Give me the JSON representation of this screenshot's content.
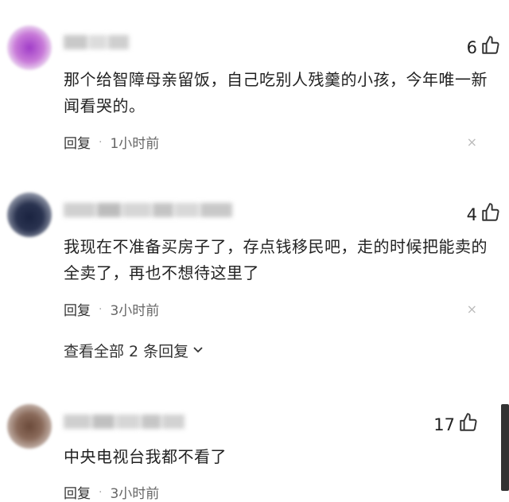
{
  "comments": [
    {
      "likes": "6",
      "text": "那个给智障母亲留饭，自己吃别人残羹的小孩，今年唯一新闻看哭的。",
      "reply_label": "回复",
      "separator": "·",
      "time": "1小时前",
      "close": "×"
    },
    {
      "likes": "4",
      "text": "我现在不准备买房子了，存点钱移民吧，走的时候把能卖的全卖了，再也不想待这里了",
      "reply_label": "回复",
      "separator": "·",
      "time": "3小时前",
      "close": "×",
      "more_replies": "查看全部 2 条回复"
    },
    {
      "likes": "17",
      "text": "中央电视台我都不看了",
      "reply_label": "回复",
      "separator": "·",
      "time": "3小时前"
    }
  ],
  "icons": {
    "like": "thumbs-up-icon",
    "close": "close-icon",
    "expand": "chevron-down-icon"
  },
  "colors": {
    "text": "#222222",
    "meta": "#666666",
    "close": "#bbbbbb"
  }
}
